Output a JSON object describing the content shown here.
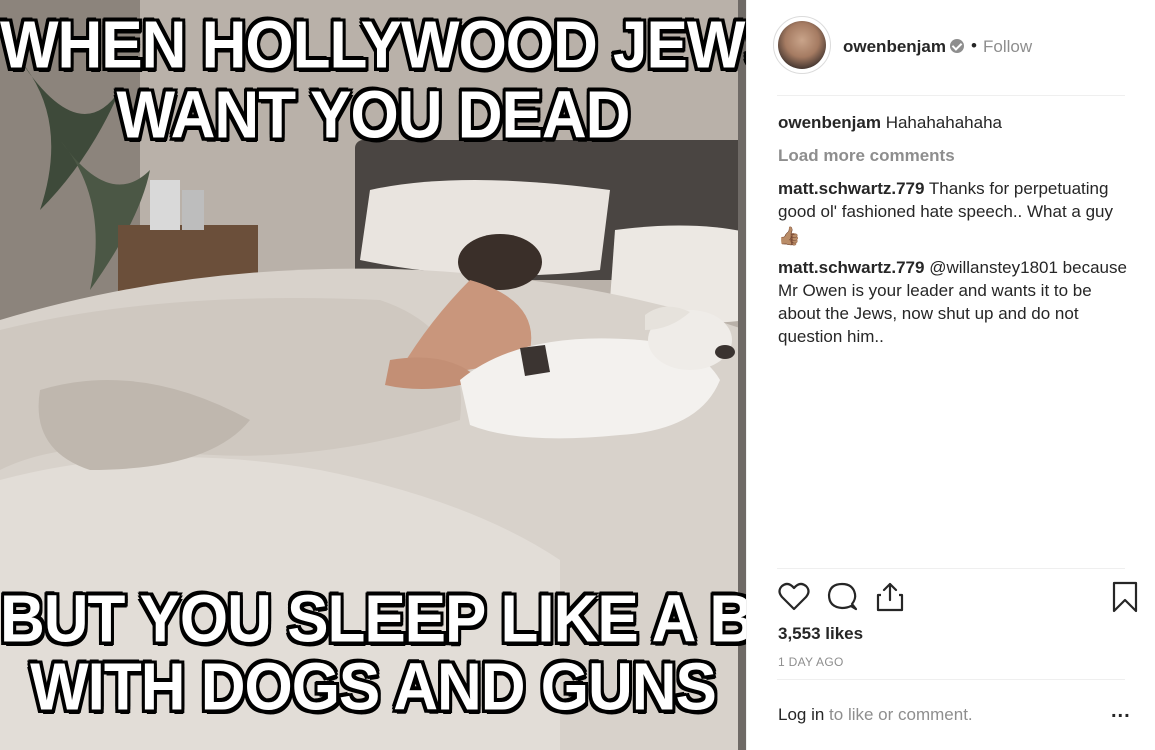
{
  "post_image": {
    "meme_top_line_1": "WHEN HOLLYWOOD JEWS",
    "meme_top_line_2": "WANT YOU DEAD",
    "meme_bottom_line_1": "BUT YOU SLEEP LIKE A BABY",
    "meme_bottom_line_2": "WITH DOGS AND GUNS"
  },
  "header": {
    "username": "owenbenjam",
    "separator": "•",
    "follow_label": "Follow",
    "avatar_icon": "avatar-photo"
  },
  "comments": {
    "caption": {
      "user": "owenbenjam",
      "text": "Hahahahahaha"
    },
    "load_more_label": "Load more comments",
    "items": [
      {
        "user": "matt.schwartz.779",
        "text": "Thanks for perpetuating good ol' fashioned hate speech.. What a guy",
        "emoji": "👍🏽"
      },
      {
        "user": "matt.schwartz.779",
        "text": "@willanstey1801 because Mr Owen is your leader and wants it to be about the Jews, now shut up and do not question him.."
      }
    ]
  },
  "actions": {
    "icons": [
      "heart-icon",
      "comment-icon",
      "share-icon",
      "bookmark-icon"
    ]
  },
  "likes_text": "3,553 likes",
  "time_ago": "1 DAY AGO",
  "footer": {
    "login_link": "Log in",
    "login_rest": " to like or comment.",
    "more_label": "..."
  },
  "colors": {
    "text_primary": "#262626",
    "text_secondary": "#8e8e8e",
    "border": "#efefef"
  }
}
